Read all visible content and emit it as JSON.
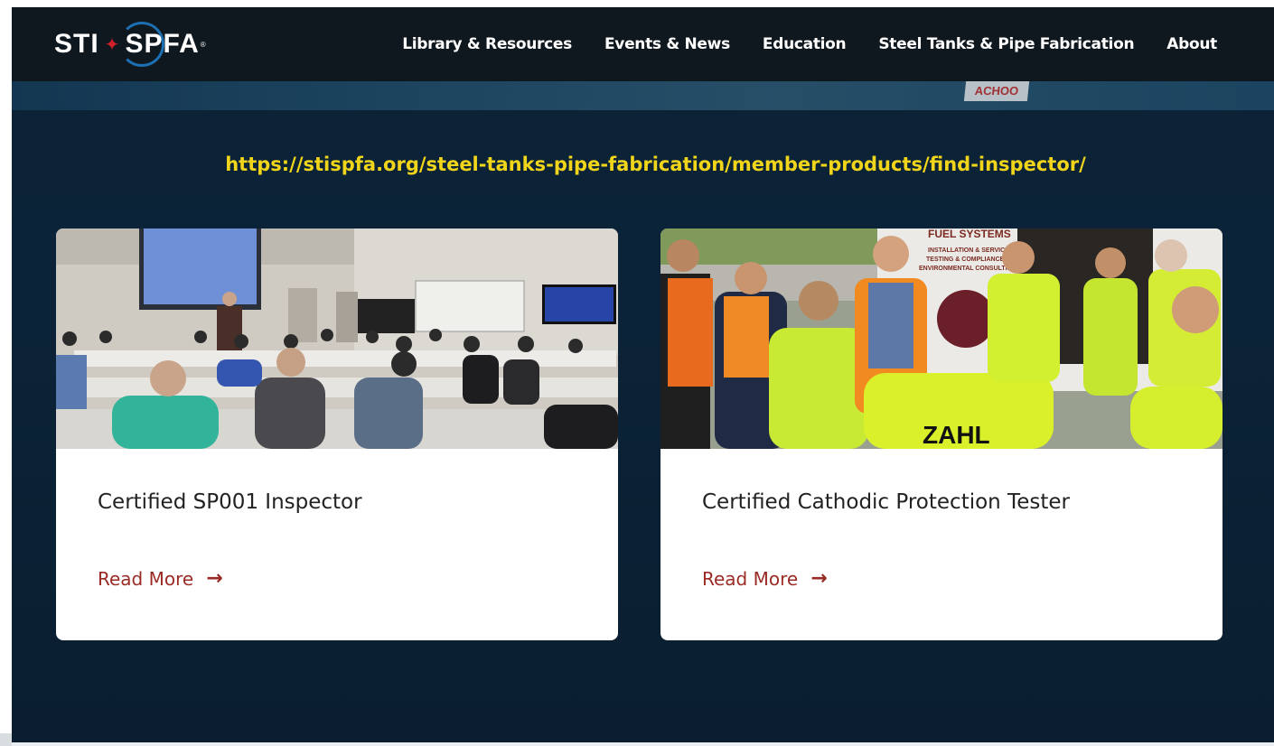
{
  "logo": {
    "left": "STI",
    "right": "SPFA",
    "reg": "®"
  },
  "nav": {
    "items": [
      "Library & Resources",
      "Events & News",
      "Education",
      "Steel Tanks & Pipe Fabrication",
      "About"
    ]
  },
  "url": "https://stispfa.org/steel-tanks-pipe-fabrication/member-products/find-inspector/",
  "cards": [
    {
      "title": "Certified SP001 Inspector",
      "link": "Read More"
    },
    {
      "title": "Certified Cathodic Protection Tester",
      "link": "Read More"
    }
  ],
  "photo2": {
    "sign_lines": [
      "FUEL SYSTEMS",
      "INSTALLATION & SERVICE",
      "TESTING & COMPLIANCE",
      "ENVIRONMENTAL CONSULTING"
    ],
    "vest_text": "ZAHL"
  },
  "colors": {
    "accent": "#f0d51a",
    "link": "#9a2b24",
    "nav_bg": "#10181f"
  }
}
